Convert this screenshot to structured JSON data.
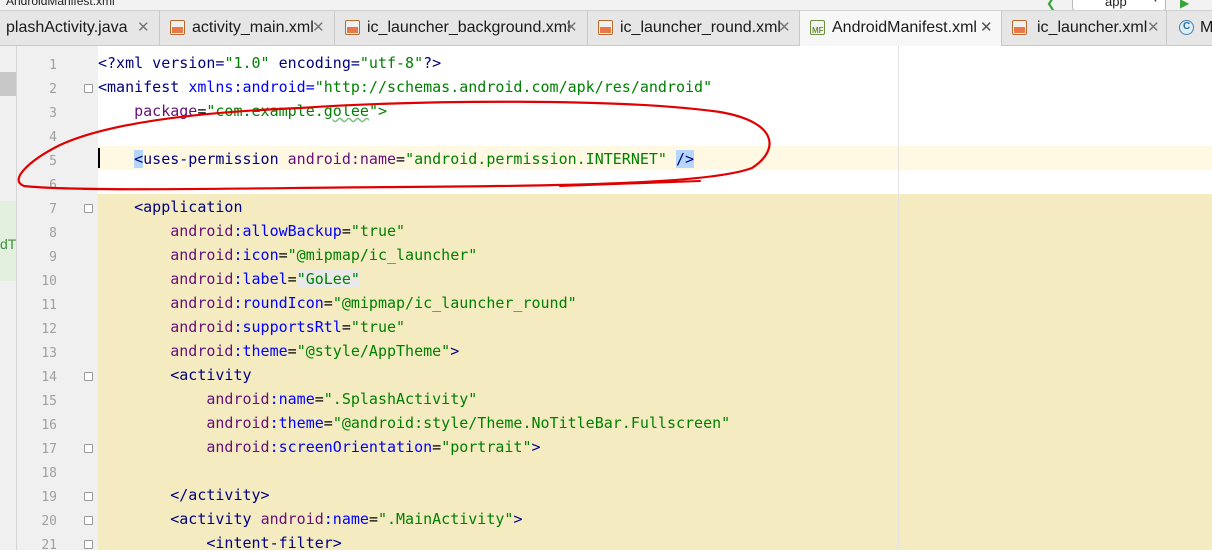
{
  "window": {
    "title": "AndroidManifest.xml"
  },
  "toolbar": {
    "run_config": "app"
  },
  "tabs": [
    {
      "label": "plashActivity.java",
      "icon": "java-class-icon",
      "active": false
    },
    {
      "label": "activity_main.xml",
      "icon": "xml-file-icon",
      "active": false
    },
    {
      "label": "ic_launcher_background.xml",
      "icon": "xml-file-icon",
      "active": false
    },
    {
      "label": "ic_launcher_round.xml",
      "icon": "xml-file-icon",
      "active": false
    },
    {
      "label": "AndroidManifest.xml",
      "icon": "manifest-file-icon",
      "active": true
    },
    {
      "label": "ic_launcher.xml",
      "icon": "xml-file-icon",
      "active": false
    },
    {
      "label": "M",
      "icon": "java-class-icon",
      "active": false
    }
  ],
  "left_panel": {
    "fragment": "dT"
  },
  "code": {
    "line_numbers": [
      "1",
      "2",
      "3",
      "4",
      "5",
      "6",
      "7",
      "8",
      "9",
      "10",
      "11",
      "12",
      "13",
      "14",
      "15",
      "16",
      "17",
      "18",
      "19",
      "20",
      "21"
    ],
    "l1": {
      "a": "<?xml version=",
      "b": "\"1.0\"",
      "c": " encoding=",
      "d": "\"utf-8\"",
      "e": "?>"
    },
    "l2": {
      "a": "<manifest ",
      "b": "xmlns:android",
      "c": "=",
      "d": "\"http://schemas.android.com/apk/res/android\""
    },
    "l3": {
      "a": "    package",
      "b": "=",
      "c": "\"com.example.",
      "d": "golee",
      "e": "\">"
    },
    "l5": {
      "a": "    ",
      "b": "<",
      "c": "uses-permission ",
      "d": "android",
      "e": ":name",
      "f": "=",
      "g": "\"android.permission.INTERNET\"",
      "h": " ",
      "i": "/>"
    },
    "l7": {
      "a": "    <application"
    },
    "l8": {
      "a": "        ",
      "b": "android",
      "c": ":allowBackup",
      "d": "=",
      "e": "\"true\""
    },
    "l9": {
      "a": "        ",
      "b": "android",
      "c": ":icon",
      "d": "=",
      "e": "\"@mipmap/ic_launcher\""
    },
    "l10": {
      "a": "        ",
      "b": "android",
      "c": ":label",
      "d": "=",
      "e": "\"GoLee\""
    },
    "l11": {
      "a": "        ",
      "b": "android",
      "c": ":roundIcon",
      "d": "=",
      "e": "\"@mipmap/ic_launcher_round\""
    },
    "l12": {
      "a": "        ",
      "b": "android",
      "c": ":supportsRtl",
      "d": "=",
      "e": "\"true\""
    },
    "l13": {
      "a": "        ",
      "b": "android",
      "c": ":theme",
      "d": "=",
      "e": "\"@style/AppTheme\"",
      "f": ">"
    },
    "l14": {
      "a": "        <activity"
    },
    "l15": {
      "a": "            ",
      "b": "android",
      "c": ":name",
      "d": "=",
      "e": "\".SplashActivity\""
    },
    "l16": {
      "a": "            ",
      "b": "android",
      "c": ":theme",
      "d": "=",
      "e": "\"@android:style/Theme.NoTitleBar.Fullscreen\""
    },
    "l17": {
      "a": "            ",
      "b": "android",
      "c": ":screenOrientation",
      "d": "=",
      "e": "\"portrait\"",
      "f": ">"
    },
    "l19": {
      "a": "        </activity>"
    },
    "l20": {
      "a": "        <activity ",
      "b": "android",
      "c": ":name",
      "d": "=",
      "e": "\".MainActivity\"",
      "f": ">"
    },
    "l21": {
      "a": "            <intent-filter>"
    }
  },
  "colors": {
    "tag": "#000080",
    "attribute": "#660e7a",
    "namespace": "#0000ff",
    "string": "#008000",
    "highlight_band": "#f4ebc0",
    "annotation": "#e00000"
  }
}
